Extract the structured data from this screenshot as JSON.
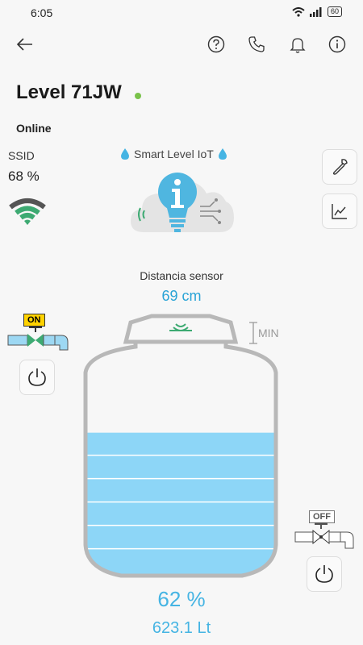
{
  "status_bar": {
    "time": "6:05",
    "battery": "60"
  },
  "header": {
    "title": "Level 71JW",
    "status": "Online",
    "colors": {
      "online": "#79c24a"
    }
  },
  "wifi": {
    "label": "SSID",
    "value": "68 %"
  },
  "brand": {
    "name": "Smart Level IoT"
  },
  "sensor": {
    "label": "Distancia sensor",
    "value": "69 cm"
  },
  "tank": {
    "min_label": "MIN",
    "level_percent": 62,
    "percent_text": "62 %",
    "volume_text": "623.1 Lt",
    "colors": {
      "water": "#8dd6f7",
      "line": "#b8b8b8",
      "accent": "#45b4e3"
    }
  },
  "valves": {
    "inlet": {
      "state_label": "ON"
    },
    "outlet": {
      "state_label": "OFF"
    }
  },
  "icons": {
    "back": "arrow-left-icon",
    "help": "question-icon",
    "phone": "phone-icon",
    "bell": "bell-icon",
    "info": "info-icon",
    "wrench": "wrench-icon",
    "chart": "chart-icon",
    "power": "power-icon"
  }
}
